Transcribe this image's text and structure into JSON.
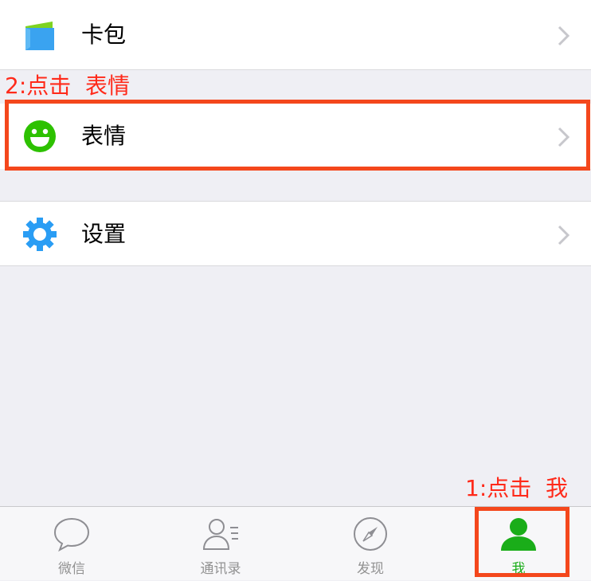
{
  "settings_list": {
    "items": [
      {
        "id": "kabao",
        "label": "卡包",
        "icon": "wallet-icon"
      },
      {
        "id": "biaoqing",
        "label": "表情",
        "icon": "smiley-icon"
      },
      {
        "id": "shezhi",
        "label": "设置",
        "icon": "gear-icon"
      }
    ]
  },
  "annotations": {
    "step2": "2:点击  表情",
    "step1": "1:点击  我"
  },
  "tabbar": {
    "tabs": [
      {
        "label": "微信",
        "icon": "chat-bubble-icon",
        "active": false
      },
      {
        "label": "通讯录",
        "icon": "contacts-icon",
        "active": false
      },
      {
        "label": "发现",
        "icon": "compass-icon",
        "active": false
      },
      {
        "label": "我",
        "icon": "person-icon",
        "active": true
      }
    ]
  },
  "colors": {
    "background": "#efeff4",
    "annotation_red": "#ff2a1a",
    "highlight_border": "#f4471c",
    "active_green": "#1aad19",
    "inactive_gray": "#929292",
    "wallet_blue": "#3aa3f0",
    "wallet_green": "#7ed321",
    "smiley_green": "#2dc100",
    "gear_blue": "#2a9df4"
  }
}
